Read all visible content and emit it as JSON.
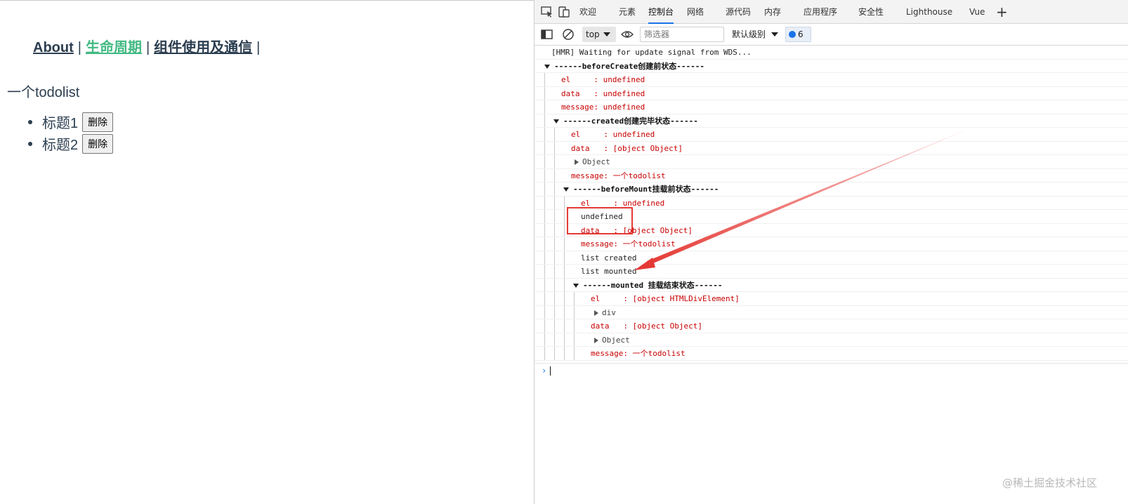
{
  "app": {
    "nav": {
      "about": "About",
      "lifecycle": "生命周期",
      "components": "组件使用及通信",
      "separator": "|"
    },
    "title": "一个todolist",
    "todos": [
      {
        "label": "标题1",
        "delete_label": "删除"
      },
      {
        "label": "标题2",
        "delete_label": "删除"
      }
    ]
  },
  "devtools": {
    "tabs": [
      {
        "label": "欢迎",
        "active": false
      },
      {
        "label": "元素",
        "active": false
      },
      {
        "label": "控制台",
        "active": true
      },
      {
        "label": "网络",
        "active": false
      },
      {
        "label": "源代码",
        "active": false
      },
      {
        "label": "内存",
        "active": false
      },
      {
        "label": "应用程序",
        "active": false
      },
      {
        "label": "安全性",
        "active": false
      },
      {
        "label": "Lighthouse",
        "active": false
      },
      {
        "label": "Vue",
        "active": false
      }
    ],
    "add_tab": "+",
    "toolbar": {
      "context": "top",
      "filter_placeholder": "筛选器",
      "levels": "默认级别",
      "issues_count": "6"
    },
    "console_lines": [
      {
        "text": "[HMR] Waiting for update signal from WDS...",
        "style": "log"
      },
      {
        "text": "------beforeCreate创建前状态------",
        "style": "group"
      },
      {
        "text": "el     : undefined",
        "style": "red"
      },
      {
        "text": "data   : undefined",
        "style": "red"
      },
      {
        "text": "message: undefined",
        "style": "red"
      },
      {
        "text": "------created创建完毕状态------",
        "style": "group"
      },
      {
        "text": "el     : undefined",
        "style": "red"
      },
      {
        "text": "data   : [object Object]",
        "style": "red"
      },
      {
        "text": "Object",
        "style": "expandable"
      },
      {
        "text": "message: 一个todolist",
        "style": "red"
      },
      {
        "text": "------beforeMount挂载前状态------",
        "style": "group"
      },
      {
        "text": "el     : undefined",
        "style": "red"
      },
      {
        "text": "undefined",
        "style": "log"
      },
      {
        "text": "data   : [object Object]",
        "style": "red"
      },
      {
        "text": "message: 一个todolist",
        "style": "red"
      },
      {
        "text": "list created",
        "style": "log"
      },
      {
        "text": "list mounted",
        "style": "log"
      },
      {
        "text": "------mounted 挂载结束状态------",
        "style": "group"
      },
      {
        "text": "el     : [object HTMLDivElement]",
        "style": "red"
      },
      {
        "text": "div",
        "style": "expandable"
      },
      {
        "text": "data   : [object Object]",
        "style": "red"
      },
      {
        "text": "Object",
        "style": "expandable"
      },
      {
        "text": "message: 一个todolist",
        "style": "red"
      }
    ],
    "prompt_symbol": "›"
  },
  "colors": {
    "app_text": "#2c3e50",
    "router_active": "#42b983",
    "console_red": "#c80000",
    "tab_underline": "#1a73e8",
    "annotation_red": "#e53935"
  },
  "watermark": "@稀土掘金技术社区"
}
